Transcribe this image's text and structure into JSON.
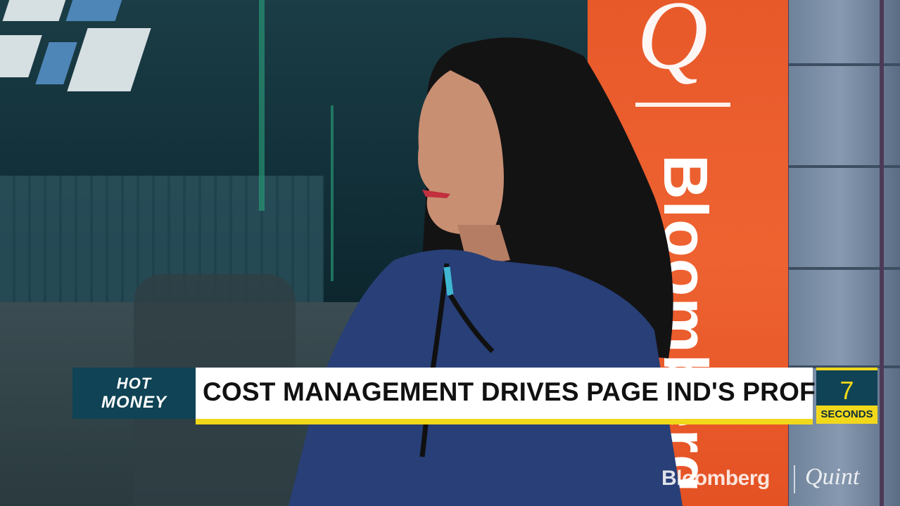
{
  "background": {
    "panel_letter": "Q",
    "panel_vertical_text": "Bloomberg"
  },
  "lower_third": {
    "brand_line1": "HOT",
    "brand_line2": "MONEY",
    "headline": "COST MANAGEMENT DRIVES PAGE IND'S PROFIT",
    "timer_value": "7",
    "timer_label": "SECONDS"
  },
  "watermark": {
    "left": "Bloomberg",
    "right": "Quint"
  },
  "colors": {
    "brand_teal": "#0f4355",
    "accent_yellow": "#f2d81b",
    "panel_orange": "#e8592a",
    "headline_bg": "#ffffff",
    "headline_text": "#111111"
  }
}
